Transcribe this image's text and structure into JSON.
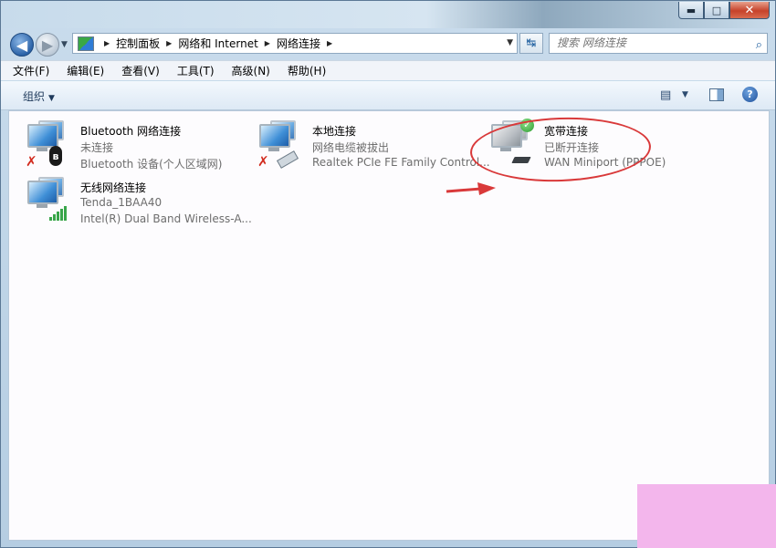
{
  "window": {
    "caption_buttons": {
      "minimize": "▬",
      "maximize": "□",
      "close": "✕"
    }
  },
  "nav": {
    "back_glyph": "◀",
    "forward_glyph": "▶",
    "history_glyph": "▼",
    "breadcrumbs": [
      "控制面板",
      "网络和 Internet",
      "网络连接"
    ],
    "crumb_separator": "▶",
    "dropdown_glyph": "▼",
    "refresh_glyph": "↹",
    "search_placeholder": "搜索 网络连接",
    "search_icon_glyph": "⌕"
  },
  "menu": {
    "items": [
      "文件(F)",
      "编辑(E)",
      "查看(V)",
      "工具(T)",
      "高级(N)",
      "帮助(H)"
    ]
  },
  "command_bar": {
    "organize_label": "组织",
    "organize_arrow": "▼",
    "views_glyph": "▤",
    "views_arrow": "▼",
    "help_glyph": "?"
  },
  "connections": [
    {
      "name": "Bluetooth 网络连接",
      "status": "未连接",
      "device": "Bluetooth 设备(个人区域网)",
      "icon": "bluetooth-network-icon",
      "badge_glyph": "✗",
      "bt_glyph": "ʙ"
    },
    {
      "name": "本地连接",
      "status": "网络电缆被拔出",
      "device": "Realtek PCIe FE Family Control...",
      "icon": "ethernet-network-icon",
      "badge_glyph": "✗"
    },
    {
      "name": "宽带连接",
      "status": "已断开连接",
      "device": "WAN Miniport (PPPOE)",
      "icon": "broadband-network-icon",
      "badge_glyph": "✓"
    },
    {
      "name": "无线网络连接",
      "status": "Tenda_1BAA40",
      "device": "Intel(R) Dual Band Wireless-A...",
      "icon": "wireless-network-icon"
    }
  ],
  "colors": {
    "annotation_red": "#d9393a",
    "watermark_pink": "#f3b6ec"
  }
}
